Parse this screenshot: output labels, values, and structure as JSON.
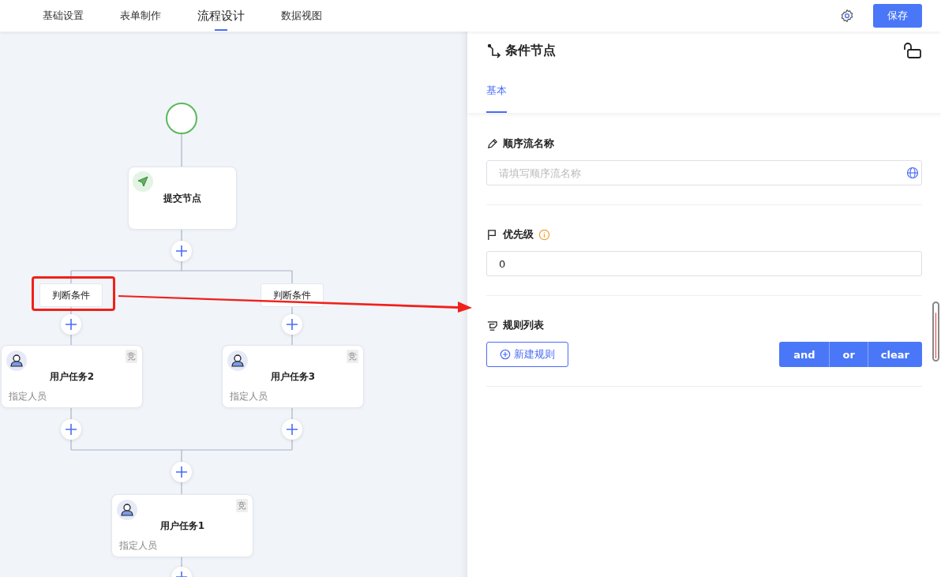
{
  "top_tabs": [
    {
      "label": "基础设置",
      "selected": false
    },
    {
      "label": "表单制作",
      "selected": false
    },
    {
      "label": "流程设计",
      "selected": true
    },
    {
      "label": "数据视图",
      "selected": false
    }
  ],
  "save_button": "保存",
  "flow": {
    "submit": {
      "title": "提交节点"
    },
    "branches": [
      {
        "condition": {
          "label": "判断条件",
          "highlighted": true
        },
        "task": {
          "title": "用户任务2",
          "badge": "竞",
          "assignee": "指定人员"
        }
      },
      {
        "condition": {
          "label": "判断条件",
          "highlighted": false
        },
        "task": {
          "title": "用户任务3",
          "badge": "竞",
          "assignee": "指定人员"
        }
      }
    ],
    "after": {
      "title": "用户任务1",
      "badge": "竞",
      "assignee": "指定人员"
    }
  },
  "panel": {
    "title": "条件节点",
    "tabs": [
      {
        "label": "基本",
        "selected": true
      }
    ],
    "sections": [
      {
        "kind": "text",
        "label": "顺序流名称",
        "placeholder": "请填写顺序流名称"
      },
      {
        "kind": "number",
        "label": "优先级",
        "info": true,
        "value": "0"
      },
      {
        "kind": "rules",
        "label": "规则列表",
        "add_button": "新建规则",
        "buttons": [
          "and",
          "or",
          "clear"
        ]
      }
    ]
  }
}
